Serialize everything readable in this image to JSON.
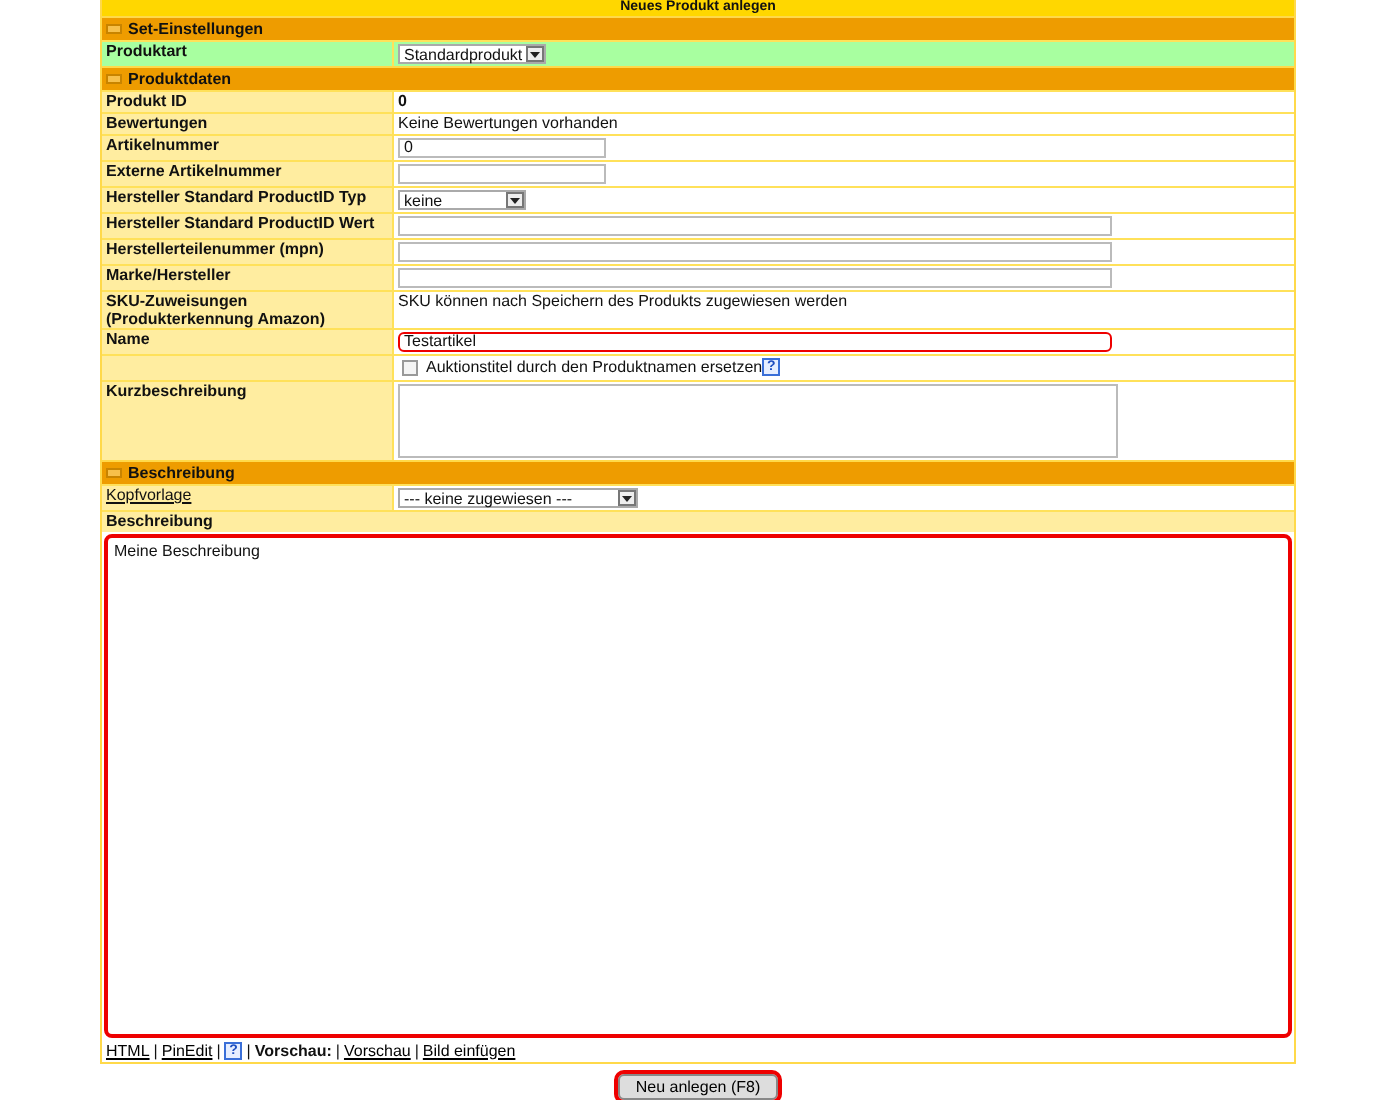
{
  "title": "Neues Produkt anlegen",
  "sections": [
    {
      "title": "Set-Einstellungen",
      "expanded": true,
      "rows": [
        {
          "label": "Produktart",
          "kind": "select",
          "value": "Standardprodukt",
          "highlighted": true
        }
      ]
    },
    {
      "title": "Produktdaten",
      "expanded": true,
      "rows": [
        {
          "label": "Produkt ID",
          "kind": "text",
          "value": "0",
          "bold": true
        },
        {
          "label": "Bewertungen",
          "kind": "text",
          "value": "Keine Bewertungen vorhanden",
          "bold": false
        },
        {
          "label": "Artikelnummer",
          "kind": "input",
          "value": "0",
          "highlighted": false
        },
        {
          "label": "Externe Artikelnummer",
          "kind": "input",
          "value": "",
          "highlighted": false
        },
        {
          "label": "Hersteller Standard ProductID Typ",
          "kind": "select",
          "value": "keine",
          "highlighted": false
        },
        {
          "label": "Hersteller Standard ProductID Wert",
          "kind": "wideinput",
          "value": "",
          "highlighted": false
        },
        {
          "label": "Herstellerteilenummer (mpn)",
          "kind": "wideinput",
          "value": "",
          "highlighted": false
        },
        {
          "label": "Marke/Hersteller",
          "kind": "wideinput",
          "value": "",
          "highlighted": false
        },
        {
          "label": "SKU-Zuweisungen\n(Produkterkennung Amazon)",
          "kind": "text",
          "value": "SKU können nach Speichern des Produkts zugewiesen werden",
          "bold": false
        },
        {
          "label": "Name",
          "kind": "wideinput",
          "value": "Testartikel",
          "highlighted": true
        },
        {
          "label": "",
          "kind": "checkbox",
          "value": "Auktionstitel durch den Produktnamen ersetzen",
          "checked": false,
          "help": "?"
        },
        {
          "label": "Kurzbeschreibung",
          "kind": "textarea",
          "value": ""
        }
      ]
    },
    {
      "title": "Beschreibung",
      "expanded": true,
      "rows": [
        {
          "label": "Kopfvorlage",
          "label_link": true,
          "kind": "wideselect",
          "value": "--- keine zugewiesen ---",
          "highlighted": false
        }
      ]
    }
  ],
  "description": {
    "label": "Beschreibung",
    "value": "Meine Beschreibung",
    "highlighted": true
  },
  "toolbar": [
    {
      "kind": "link",
      "text": "HTML"
    },
    {
      "kind": "sep",
      "text": "|"
    },
    {
      "kind": "link",
      "text": "PinEdit"
    },
    {
      "kind": "sep",
      "text": "|"
    },
    {
      "kind": "help",
      "text": "?"
    },
    {
      "kind": "sep",
      "text": "|"
    },
    {
      "kind": "label",
      "text": "Vorschau:"
    },
    {
      "kind": "sep",
      "text": "|"
    },
    {
      "kind": "link",
      "text": "Vorschau"
    },
    {
      "kind": "sep",
      "text": "|"
    },
    {
      "kind": "link",
      "text": "Bild einfügen"
    }
  ],
  "submit": {
    "label": "Neu anlegen (F8)",
    "highlighted": true
  }
}
